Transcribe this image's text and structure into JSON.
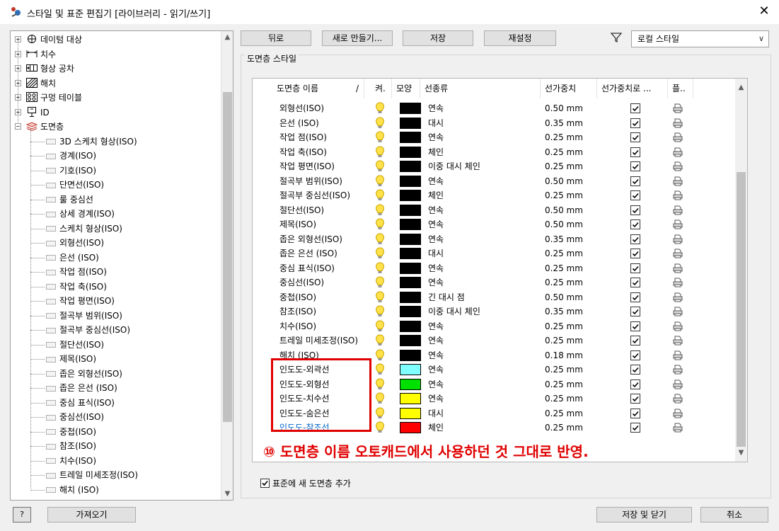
{
  "window": {
    "title": "스타일 및 표준 편집기 [라이브러리 - 읽기/쓰기]",
    "close_glyph": "✕"
  },
  "tree": {
    "top_items": [
      {
        "label": "데이텀 대상",
        "icon": "datum-target-icon"
      },
      {
        "label": "치수",
        "icon": "dimension-icon"
      },
      {
        "label": "형상 공차",
        "icon": "geometric-tolerance-icon"
      },
      {
        "label": "해치",
        "icon": "hatch-icon"
      },
      {
        "label": "구멍 테이블",
        "icon": "hole-table-icon"
      },
      {
        "label": "ID",
        "icon": "id-icon"
      },
      {
        "label": "도면층",
        "icon": "layers-icon"
      }
    ],
    "layer_children": [
      "3D 스케치 형상(ISO)",
      "경계(ISO)",
      "기호(ISO)",
      "단면선(ISO)",
      "룰 중심선",
      "상세 경계(ISO)",
      "스케치 형상(ISO)",
      "외형선(ISO)",
      "은선 (ISO)",
      "작업 점(ISO)",
      "작업 축(ISO)",
      "작업 평면(ISO)",
      "절곡부 범위(ISO)",
      "절곡부 중심선(ISO)",
      "절단선(ISO)",
      "제목(ISO)",
      "좁은 외형선(ISO)",
      "좁은 은선 (ISO)",
      "중심 표식(ISO)",
      "중심선(ISO)",
      "중첩(ISO)",
      "참조(ISO)",
      "치수(ISO)",
      "트레일 미세조정(ISO)",
      "해치 (ISO)"
    ]
  },
  "toolbar": {
    "back": "뒤로",
    "new": "새로 만들기...",
    "save": "저장",
    "reset": "재설정",
    "filter_value": "로컬 스타일"
  },
  "group_title": "도면층 스타일",
  "columns": {
    "name": "도면층 이름",
    "sort": "/",
    "on": "켜.",
    "shape": "모양",
    "linetype": "선종류",
    "weight": "선가중치",
    "scale": "선가중치로 ...",
    "plot": "플.."
  },
  "colors": {
    "black": "#000000",
    "cyan": "#80ffff",
    "green": "#00e000",
    "yellow": "#ffff00",
    "red": "#ff0000",
    "link": "#0066cc",
    "annotation": "#e00000"
  },
  "layers": [
    {
      "name": "외형선(ISO)",
      "color": "#000000",
      "linetype": "연속",
      "weight": "0.50 mm"
    },
    {
      "name": "은선 (ISO)",
      "color": "#000000",
      "linetype": "대시",
      "weight": "0.35 mm"
    },
    {
      "name": "작업 점(ISO)",
      "color": "#000000",
      "linetype": "연속",
      "weight": "0.25 mm"
    },
    {
      "name": "작업 축(ISO)",
      "color": "#000000",
      "linetype": "체인",
      "weight": "0.25 mm"
    },
    {
      "name": "작업 평면(ISO)",
      "color": "#000000",
      "linetype": "이중 대시 체인",
      "weight": "0.25 mm"
    },
    {
      "name": "절곡부 범위(ISO)",
      "color": "#000000",
      "linetype": "연속",
      "weight": "0.50 mm"
    },
    {
      "name": "절곡부 중심선(ISO)",
      "color": "#000000",
      "linetype": "체인",
      "weight": "0.25 mm"
    },
    {
      "name": "절단선(ISO)",
      "color": "#000000",
      "linetype": "연속",
      "weight": "0.50 mm"
    },
    {
      "name": "제목(ISO)",
      "color": "#000000",
      "linetype": "연속",
      "weight": "0.50 mm"
    },
    {
      "name": "좁은 외형선(ISO)",
      "color": "#000000",
      "linetype": "연속",
      "weight": "0.35 mm"
    },
    {
      "name": "좁은 은선 (ISO)",
      "color": "#000000",
      "linetype": "대시",
      "weight": "0.25 mm"
    },
    {
      "name": "중심 표식(ISO)",
      "color": "#000000",
      "linetype": "연속",
      "weight": "0.25 mm"
    },
    {
      "name": "중심선(ISO)",
      "color": "#000000",
      "linetype": "연속",
      "weight": "0.25 mm"
    },
    {
      "name": "중첩(ISO)",
      "color": "#000000",
      "linetype": "긴 대시 점",
      "weight": "0.50 mm"
    },
    {
      "name": "참조(ISO)",
      "color": "#000000",
      "linetype": "이중 대시 체인",
      "weight": "0.35 mm"
    },
    {
      "name": "치수(ISO)",
      "color": "#000000",
      "linetype": "연속",
      "weight": "0.25 mm"
    },
    {
      "name": "트레일 미세조정(ISO)",
      "color": "#000000",
      "linetype": "연속",
      "weight": "0.25 mm"
    },
    {
      "name": "해치 (ISO)",
      "color": "#000000",
      "linetype": "연속",
      "weight": "0.18 mm"
    },
    {
      "name": "인도도-외곽선",
      "color": "#80ffff",
      "linetype": "연속",
      "weight": "0.25 mm"
    },
    {
      "name": "인도도-외형선",
      "color": "#00e000",
      "linetype": "연속",
      "weight": "0.25 mm"
    },
    {
      "name": "인도도-치수선",
      "color": "#ffff00",
      "linetype": "연속",
      "weight": "0.25 mm"
    },
    {
      "name": "인도도-숨은선",
      "color": "#ffff00",
      "linetype": "대시",
      "weight": "0.25 mm"
    },
    {
      "name": "인도도-참조선",
      "color": "#ff0000",
      "linetype": "체인",
      "weight": "0.25 mm",
      "link": true
    }
  ],
  "annotation": "⑩ 도면층 이름 오토캐드에서 사용하던 것 그대로 반영.",
  "add_layer_label": "표준에 새 도면층 추가",
  "footer": {
    "help": "?",
    "import": "가져오기",
    "save_close": "저장 및 닫기",
    "cancel": "취소"
  }
}
